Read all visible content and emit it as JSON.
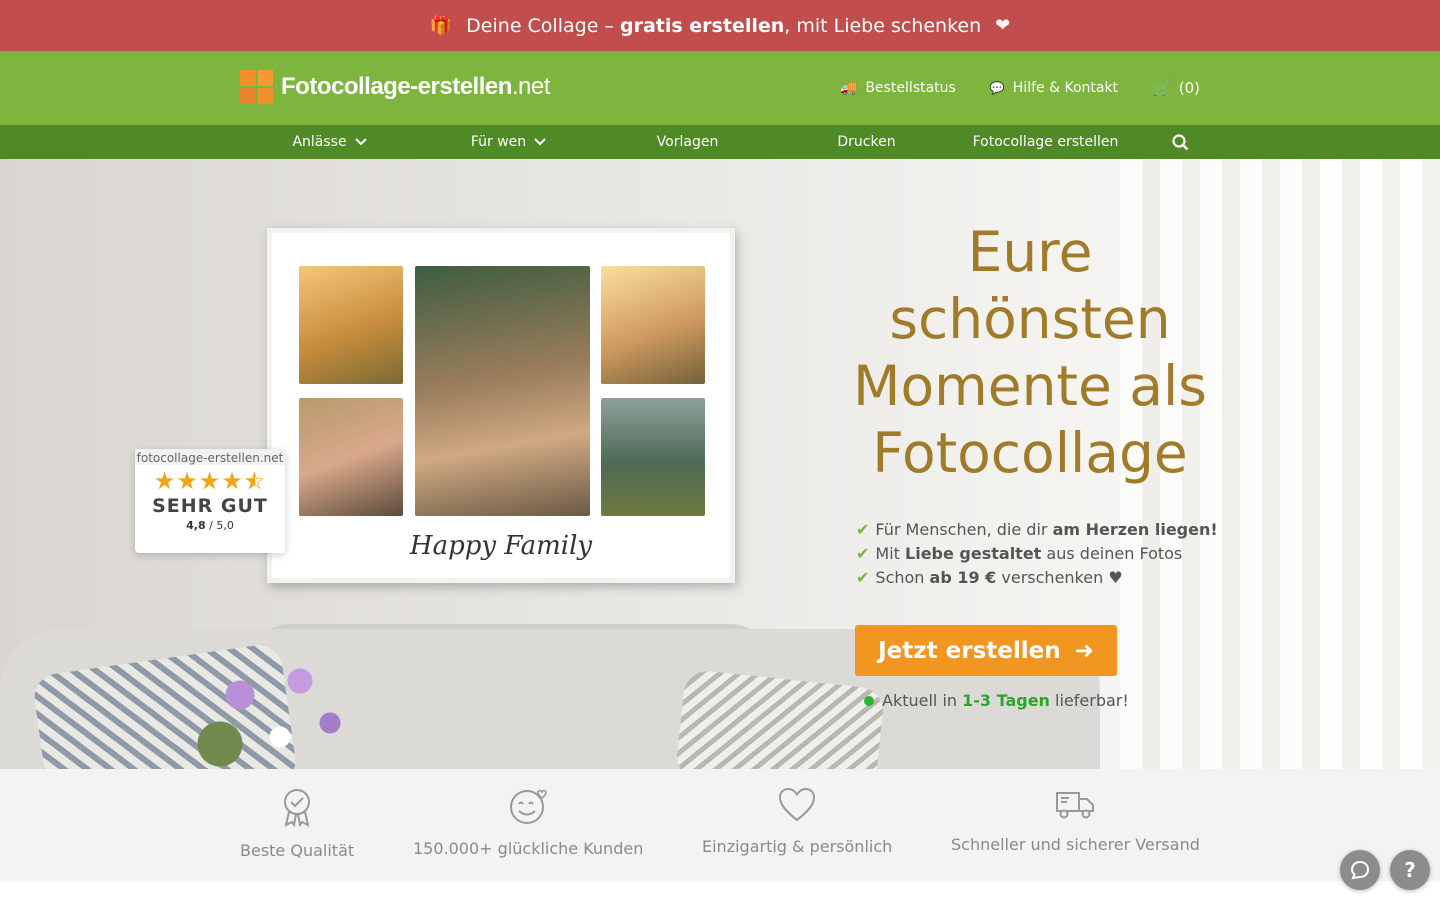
{
  "promo": {
    "icon_left": "gift-icon",
    "text_pre": "Deine Collage – ",
    "text_bold": "gratis erstellen",
    "text_post": ", mit Liebe schenken",
    "icon_right": "heart-icon",
    "color": "#c24d4d"
  },
  "header": {
    "logo_name": "Fotocollage-erstellen",
    "logo_tld": ".net",
    "links": [
      {
        "label": "Bestellstatus",
        "icon": "truck-icon"
      },
      {
        "label": "Hilfe & Kontakt",
        "icon": "chat-icon"
      }
    ],
    "cart_label": "(0)",
    "color": "#7db53f"
  },
  "nav": {
    "items": [
      {
        "label": "Anlässe",
        "dropdown": true
      },
      {
        "label": "Für wen",
        "dropdown": true
      },
      {
        "label": "Vorlagen",
        "dropdown": false
      },
      {
        "label": "Drucken",
        "dropdown": false
      },
      {
        "label": "Fotocollage erstellen",
        "dropdown": false
      }
    ],
    "color": "#4f8a26"
  },
  "hero": {
    "frame_caption": "Happy Family",
    "rating": {
      "site": "fotocollage-erstellen.net",
      "stars": 4.5,
      "label": "SEHR GUT",
      "score": "4,8",
      "score_max": " / 5,0"
    },
    "title": "Eure schönsten Momente als Fotocollage",
    "title_color": "#a07c2a",
    "bullets": [
      {
        "pre": "Für Menschen, die dir ",
        "bold": "am Herzen liegen!",
        "post": ""
      },
      {
        "pre": "Mit ",
        "bold": "Liebe gestaltet",
        "post": " aus deinen Fotos"
      },
      {
        "pre": "Schon ",
        "bold": "ab 19 €",
        "post": " verschenken ♥"
      }
    ],
    "cta_label": "Jetzt erstellen",
    "cta_color": "#f29622",
    "delivery_pre": "Aktuell in ",
    "delivery_bold": "1-3 Tagen",
    "delivery_post": " lieferbar!"
  },
  "features": [
    {
      "label": "Beste Qualität",
      "icon": "award-icon"
    },
    {
      "label": "150.000+ glückliche Kunden",
      "icon": "happy-face-icon"
    },
    {
      "label": "Einzigartig & persönlich",
      "icon": "heart-outline-icon"
    },
    {
      "label": "Schneller und sicherer Versand",
      "icon": "delivery-truck-icon"
    }
  ],
  "float_buttons": {
    "help_label": "?"
  }
}
